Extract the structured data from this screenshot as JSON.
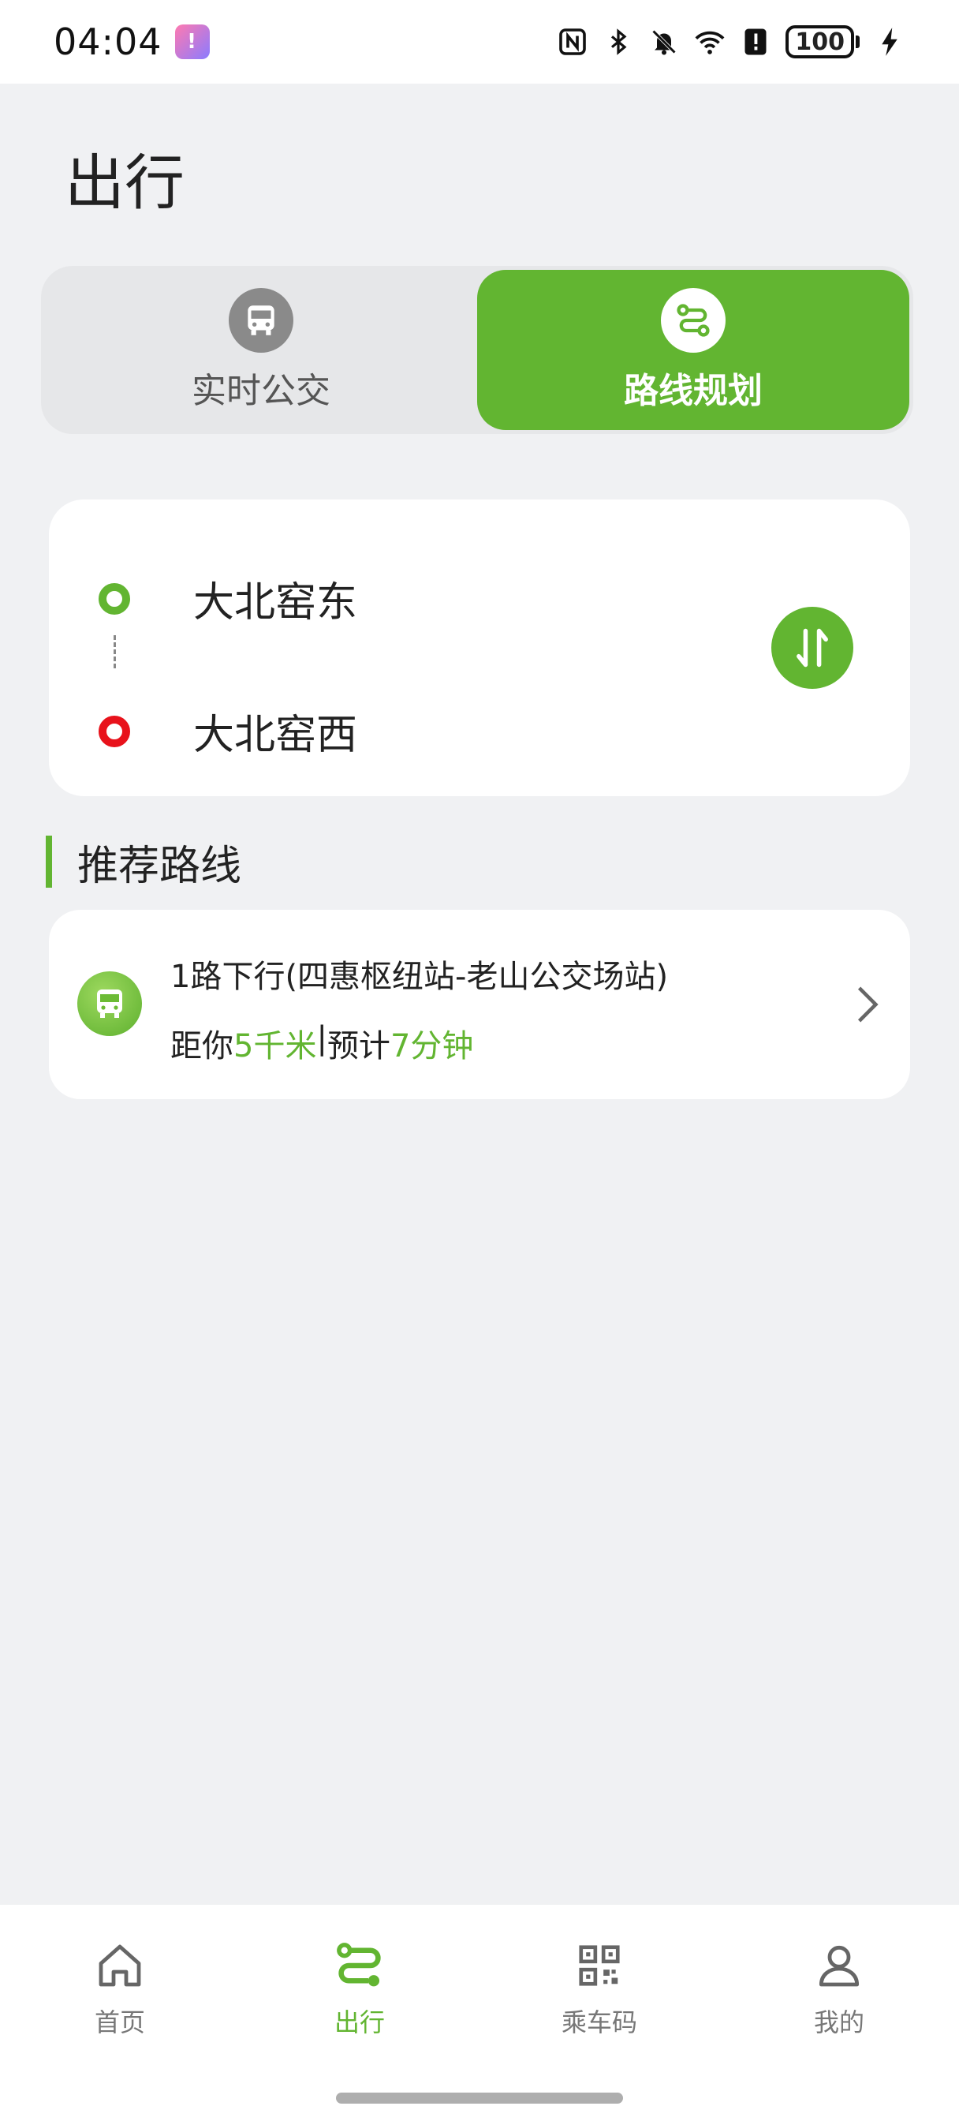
{
  "status_bar": {
    "time": "04:04",
    "battery": "100",
    "icons": [
      "nfc-icon",
      "bluetooth-icon",
      "mute-icon",
      "wifi-icon",
      "alert-icon",
      "battery-icon",
      "charging-icon"
    ]
  },
  "page": {
    "title": "出行"
  },
  "segment": {
    "tabs": [
      {
        "label": "实时公交",
        "icon": "bus-icon",
        "active": false
      },
      {
        "label": "路线规划",
        "icon": "route-icon",
        "active": true
      }
    ]
  },
  "route": {
    "start": "大北窑东",
    "end": "大北窑西"
  },
  "recommend": {
    "title": "推荐路线",
    "items": [
      {
        "name": "1路下行(四惠枢纽站-老山公交场站)",
        "distance_prefix": "距你",
        "distance": "5千米",
        "separator": "|",
        "eta_prefix": "预计",
        "eta": "7分钟"
      }
    ]
  },
  "tabbar": {
    "items": [
      {
        "label": "首页",
        "icon": "home-icon"
      },
      {
        "label": "出行",
        "icon": "route-icon",
        "active": true
      },
      {
        "label": "乘车码",
        "icon": "qr-code-icon"
      },
      {
        "label": "我的",
        "icon": "user-icon"
      }
    ]
  },
  "colors": {
    "accent": "#62b531",
    "end_dot": "#e8121b",
    "background": "#f0f1f3"
  }
}
